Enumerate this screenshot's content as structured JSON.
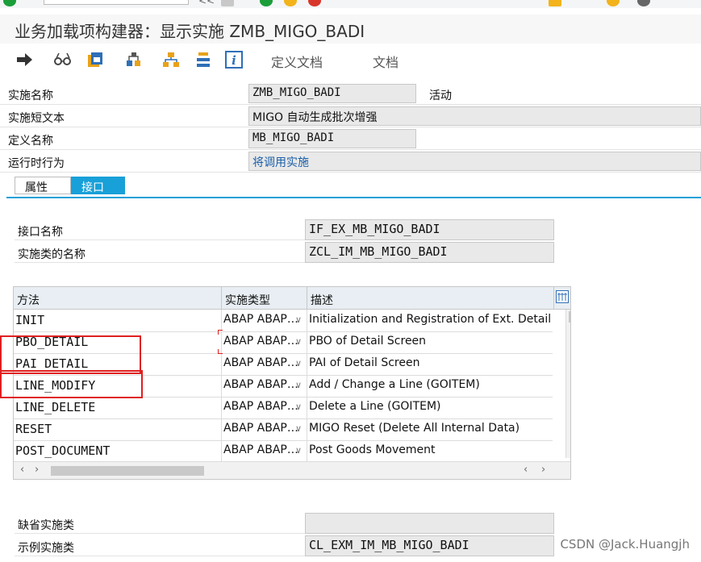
{
  "window": {
    "title": "业务加载项构建器：显示实施 ZMB_MIGO_BADI"
  },
  "toolbar": {
    "define_doc_label": "定义文档",
    "doc_label": "文档"
  },
  "header": {
    "impl_name_label": "实施名称",
    "impl_name_value": "ZMB_MIGO_BADI",
    "impl_status": "活动",
    "impl_short_text_label": "实施短文本",
    "impl_short_text_value": "MIGO 自动生成批次增强",
    "def_name_label": "定义名称",
    "def_name_value": "MB_MIGO_BADI",
    "runtime_label": "运行时行为",
    "runtime_value": "将调用实施"
  },
  "tabs": [
    {
      "label": "属性",
      "active": false
    },
    {
      "label": "接口",
      "active": true
    }
  ],
  "interface": {
    "if_name_label": "接口名称",
    "if_name_value": "IF_EX_MB_MIGO_BADI",
    "impl_class_label": "实施类的名称",
    "impl_class_value": "ZCL_IM_MB_MIGO_BADI"
  },
  "methods_table": {
    "columns": [
      "方法",
      "实施类型",
      "描述"
    ],
    "rows": [
      {
        "method": "INIT",
        "impl_type": "ABAP ABAP…",
        "desc": "Initialization and Registration of Ext. Detail Scre"
      },
      {
        "method": "PBO_DETAIL",
        "impl_type": "ABAP ABAP…",
        "desc": "PBO of Detail Screen"
      },
      {
        "method": "PAI_DETAIL",
        "impl_type": "ABAP ABAP…",
        "desc": "PAI of Detail Screen"
      },
      {
        "method": "LINE_MODIFY",
        "impl_type": "ABAP ABAP…",
        "desc": "Add / Change a Line (GOITEM)"
      },
      {
        "method": "LINE_DELETE",
        "impl_type": "ABAP ABAP…",
        "desc": "Delete a Line (GOITEM)"
      },
      {
        "method": "RESET",
        "impl_type": "ABAP ABAP…",
        "desc": "MIGO Reset (Delete All Internal Data)"
      },
      {
        "method": "POST_DOCUMENT",
        "impl_type": "ABAP ABAP…",
        "desc": "Post Goods Movement"
      }
    ]
  },
  "defaults": {
    "default_class_label": "缺省实施类",
    "default_class_value": "",
    "example_class_label": "示例实施类",
    "example_class_value": "CL_EXM_IM_MB_MIGO_BADI"
  },
  "watermark": "CSDN @Jack.Huangjh",
  "colors": {
    "accent_blue": "#18a0d8",
    "highlight_red": "#e02020",
    "link_blue": "#1a5fa8"
  },
  "icons": {
    "execute": "arrow-right-icon",
    "where_used": "glasses-icon",
    "package": "clipboard-package-icon",
    "display_object": "object-tree-icon",
    "hierarchy": "hierarchy-icon",
    "stack": "stack-list-icon",
    "info": "info-icon",
    "column_settings": "grid-settings-icon"
  }
}
